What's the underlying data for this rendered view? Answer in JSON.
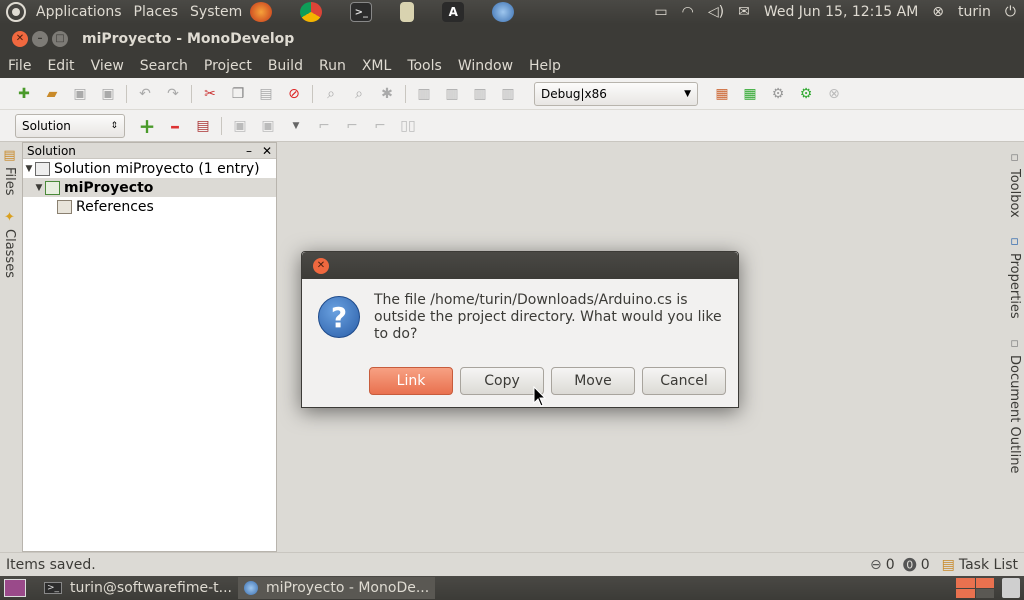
{
  "top_panel": {
    "menus": [
      "Applications",
      "Places",
      "System"
    ],
    "launchers": [
      "firefox-icon",
      "chrome-icon",
      "terminal-icon",
      "media-icon",
      "arduino-icon",
      "monodevelop-icon"
    ],
    "clock": "Wed Jun 15, 12:15 AM",
    "user": "turin"
  },
  "window": {
    "title": "miProyecto - MonoDevelop"
  },
  "menubar": {
    "items": [
      "File",
      "Edit",
      "View",
      "Search",
      "Project",
      "Build",
      "Run",
      "XML",
      "Tools",
      "Window",
      "Help"
    ]
  },
  "toolbar": {
    "config_combo": "Debug|x86",
    "pad_combo": "Solution"
  },
  "left_strip": {
    "tabs": [
      "Files",
      "Classes"
    ]
  },
  "solution_pad": {
    "title": "Solution",
    "tree": [
      {
        "label": "Solution miProyecto (1 entry)",
        "level": 0,
        "bold": false
      },
      {
        "label": "miProyecto",
        "level": 1,
        "bold": true
      },
      {
        "label": "References",
        "level": 2,
        "bold": false
      }
    ]
  },
  "right_strip": {
    "tabs": [
      "Toolbox",
      "Properties",
      "Document Outline"
    ]
  },
  "statusbar": {
    "message": "Items saved.",
    "errors": "0",
    "warnings": "0",
    "task_list": "Task List"
  },
  "taskbar": {
    "tasks": [
      "turin@softwarefime-t...",
      "miProyecto - MonoDe..."
    ]
  },
  "dialog": {
    "message": "The file /home/turin/Downloads/Arduino.cs is outside the project directory. What would you like to do?",
    "buttons": {
      "link": "Link",
      "copy": "Copy",
      "move": "Move",
      "cancel": "Cancel"
    }
  },
  "colors": {
    "panel_bg": "#3c3b37",
    "accent_orange": "#f0683f",
    "window_bg": "#dcdad5"
  }
}
